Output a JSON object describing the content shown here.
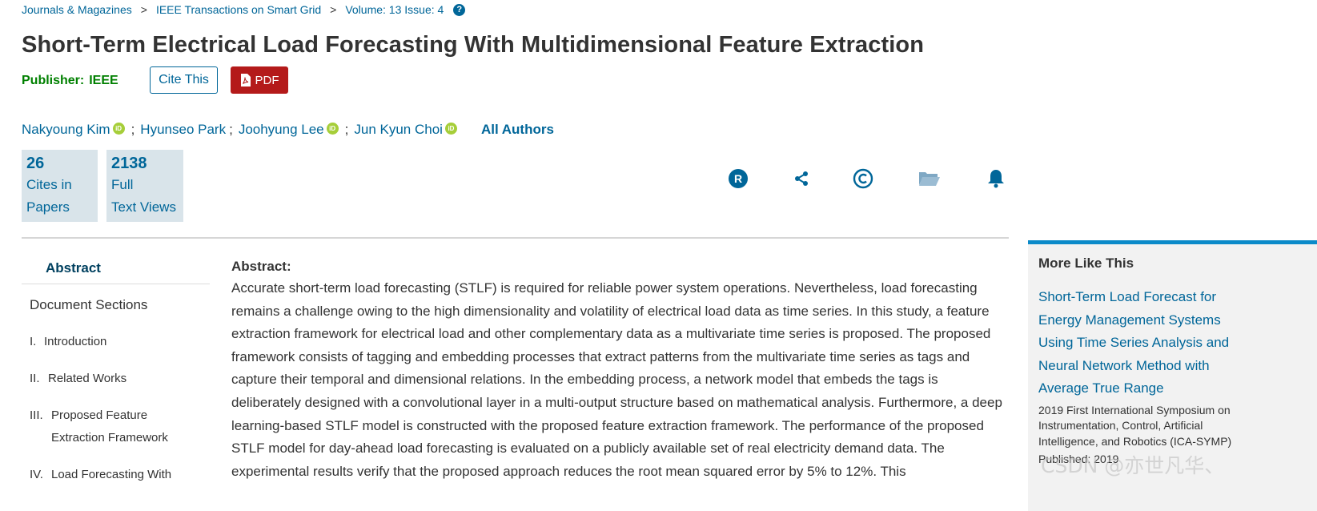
{
  "breadcrumb": {
    "items": [
      "Journals & Magazines",
      "IEEE Transactions on Smart Grid",
      "Volume: 13 Issue: 4"
    ],
    "separator": ">",
    "help_glyph": "?"
  },
  "title": "Short-Term Electrical Load Forecasting With Multidimensional Feature Extraction",
  "publisher": {
    "label": "Publisher:",
    "name": "IEEE"
  },
  "actions": {
    "cite_label": "Cite This",
    "pdf_label": "PDF"
  },
  "authors": {
    "names": [
      "Nakyoung Kim",
      "Hyunseo Park",
      "Joohyung Lee",
      "Jun Kyun Choi"
    ],
    "separator": ";",
    "orcid_glyph": "iD",
    "all_authors_label": "All Authors"
  },
  "metrics": [
    {
      "value": "26",
      "line1": "Cites in",
      "line2": "Papers"
    },
    {
      "value": "2138",
      "line1": "Full",
      "line2": "Text Views"
    }
  ],
  "toolbar_icons": [
    "rights-icon",
    "share-icon",
    "copyright-icon",
    "folder-icon",
    "alert-bell-icon"
  ],
  "nav": {
    "abstract_label": "Abstract",
    "doc_sections_label": "Document Sections",
    "items": [
      {
        "num": "I.",
        "line1": "Introduction",
        "line2": ""
      },
      {
        "num": "II.",
        "line1": "Related Works",
        "line2": ""
      },
      {
        "num": "III.",
        "line1": "Proposed Feature",
        "line2": "Extraction Framework"
      },
      {
        "num": "IV.",
        "line1": "Load Forecasting With",
        "line2": ""
      }
    ]
  },
  "abstract": {
    "label": "Abstract:",
    "text": "Accurate short-term load forecasting (STLF) is required for reliable power system operations. Nevertheless, load forecasting remains a challenge owing to the high dimensionality and volatility of electrical load data as time series. In this study, a feature extraction framework for electrical load and other complementary data as a multivariate time series is proposed. The proposed framework consists of tagging and embedding processes that extract patterns from the multivariate time series as tags and capture their temporal and dimensional relations. In the embedding process, a network model that embeds the tags is deliberately designed with a convolutional layer in a multi-output structure based on mathematical analysis. Furthermore, a deep learning-based STLF model is constructed with the proposed feature extraction framework. The performance of the proposed STLF model for day-ahead load forecasting is evaluated on a publicly available set of real electricity demand data. The experimental results verify that the proposed approach reduces the root mean squared error by 5% to 12%. This"
  },
  "more_like_this": {
    "heading": "More Like This",
    "link": "Short-Term Load Forecast for Energy Management Systems Using Time Series Analysis and Neural Network Method with Average True Range",
    "venue": "2019 First International Symposium on Instrumentation, Control, Artificial Intelligence, and Robotics (ICA-SYMP)",
    "published": "Published: 2019"
  },
  "watermark": "CSDN @亦世凡华、",
  "colors": {
    "link": "#006699",
    "publisher": "#008000",
    "pdf": "#b41a1a",
    "orcid": "#a6ce39",
    "metric_bg": "#d9e4ea",
    "accent_bar": "#0b8ac9"
  }
}
